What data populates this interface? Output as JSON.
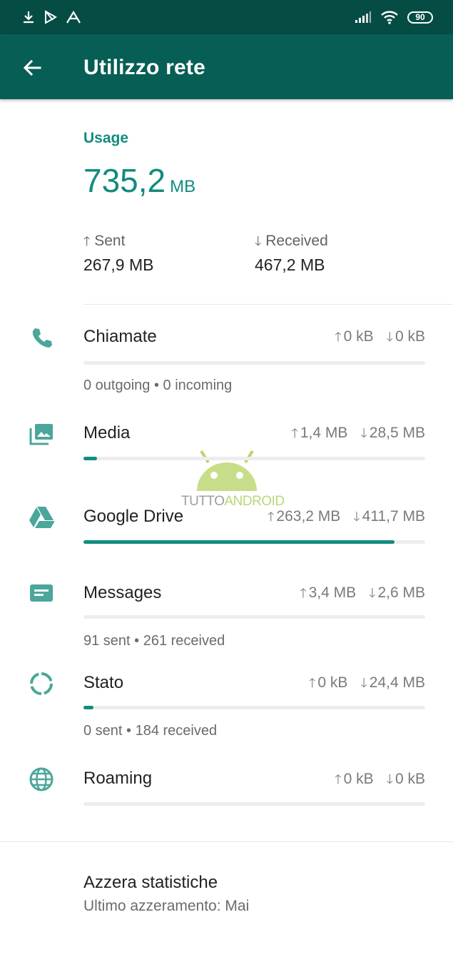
{
  "status_bar": {
    "battery": "90",
    "icons": [
      "download-icon",
      "play-store-icon",
      "app-icon",
      "signal-icon",
      "wifi-icon",
      "battery-icon"
    ]
  },
  "app_bar": {
    "title": "Utilizzo rete",
    "back_icon": "arrow-back-icon"
  },
  "summary": {
    "label": "Usage",
    "total_value": "735,2",
    "total_unit": "MB",
    "sent_label": "Sent",
    "sent_value": "267,9 MB",
    "received_label": "Received",
    "received_value": "467,2 MB"
  },
  "rows": [
    {
      "name": "Chiamate",
      "icon": "phone-icon",
      "sent": "0 kB",
      "received": "0 kB",
      "fill": 0.0,
      "sub": "0 outgoing • 0 incoming"
    },
    {
      "name": "Media",
      "icon": "photo-library-icon",
      "sent": "1,4 MB",
      "received": "28,5 MB",
      "fill": 0.04,
      "sub": ""
    },
    {
      "name": "Google Drive",
      "icon": "google-drive-icon",
      "sent": "263,2 MB",
      "received": "411,7 MB",
      "fill": 0.91,
      "sub": ""
    },
    {
      "name": "Messages",
      "icon": "message-icon",
      "sent": "3,4 MB",
      "received": "2,6 MB",
      "fill": 0.0,
      "sub": "91 sent • 261 received"
    },
    {
      "name": "Stato",
      "icon": "status-ring-icon",
      "sent": "0 kB",
      "received": "24,4 MB",
      "fill": 0.03,
      "sub": "0 sent • 184 received"
    },
    {
      "name": "Roaming",
      "icon": "globe-icon",
      "sent": "0 kB",
      "received": "0 kB",
      "fill": 0.0,
      "sub": ""
    }
  ],
  "reset": {
    "title": "Azzera statistiche",
    "subtitle": "Ultimo azzeramento: Mai"
  },
  "watermark": {
    "part1": "TUTTO",
    "part2": "ANDROID"
  },
  "colors": {
    "status_bar": "#054d44",
    "app_bar": "#075e54",
    "accent": "#128c7e"
  }
}
